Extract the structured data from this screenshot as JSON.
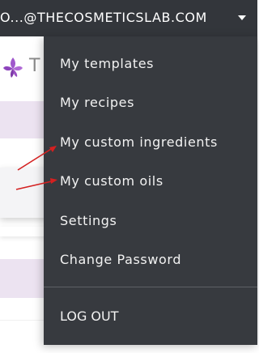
{
  "header": {
    "account_label": "O...@THECOSMETICSLAB.COM",
    "caret_icon": "caret-down-icon",
    "background_color": "#33363b"
  },
  "page": {
    "logo_letter": "T",
    "logo_icon": "purple-leaf-logo-icon",
    "accent_color": "#9b4fc2",
    "band_color": "#ece3f1"
  },
  "dropdown": {
    "background_color": "#373a3f",
    "items": [
      {
        "label": "My templates"
      },
      {
        "label": "My recipes"
      },
      {
        "label": "My custom ingredients"
      },
      {
        "label": "My custom oils"
      },
      {
        "label": "Settings"
      },
      {
        "label": "Change Password"
      }
    ],
    "logout_label": "LOG OUT"
  },
  "annotations": {
    "arrow_color": "#d42020",
    "arrow_targets": [
      "My custom ingredients",
      "My custom oils"
    ]
  }
}
